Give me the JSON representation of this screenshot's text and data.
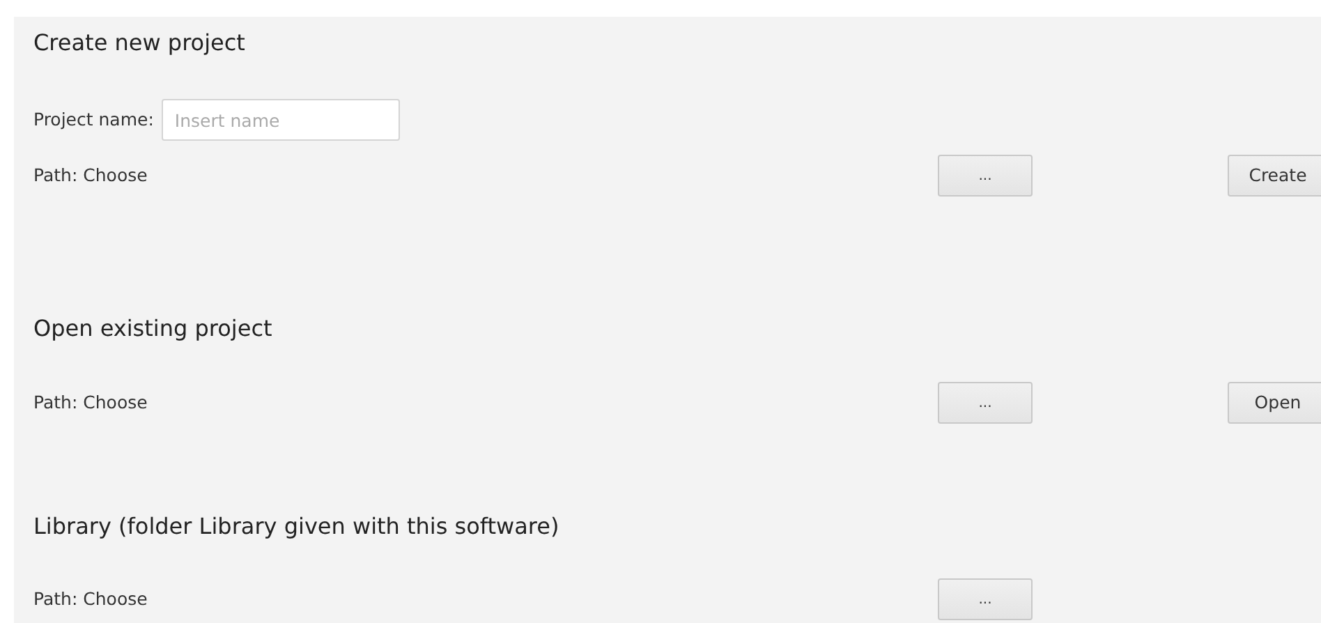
{
  "sections": [
    {
      "title": "Create new project",
      "name_field": {
        "label": "Project name:",
        "placeholder": "Insert name"
      },
      "path_label": "Path: Choose",
      "browse_button": "...",
      "action_button": "Create"
    },
    {
      "title": "Open existing project",
      "path_label": "Path: Choose",
      "browse_button": "...",
      "action_button": "Open"
    },
    {
      "title": "Library (folder Library given with this software)",
      "path_label": "Path: Choose",
      "browse_button": "..."
    }
  ]
}
